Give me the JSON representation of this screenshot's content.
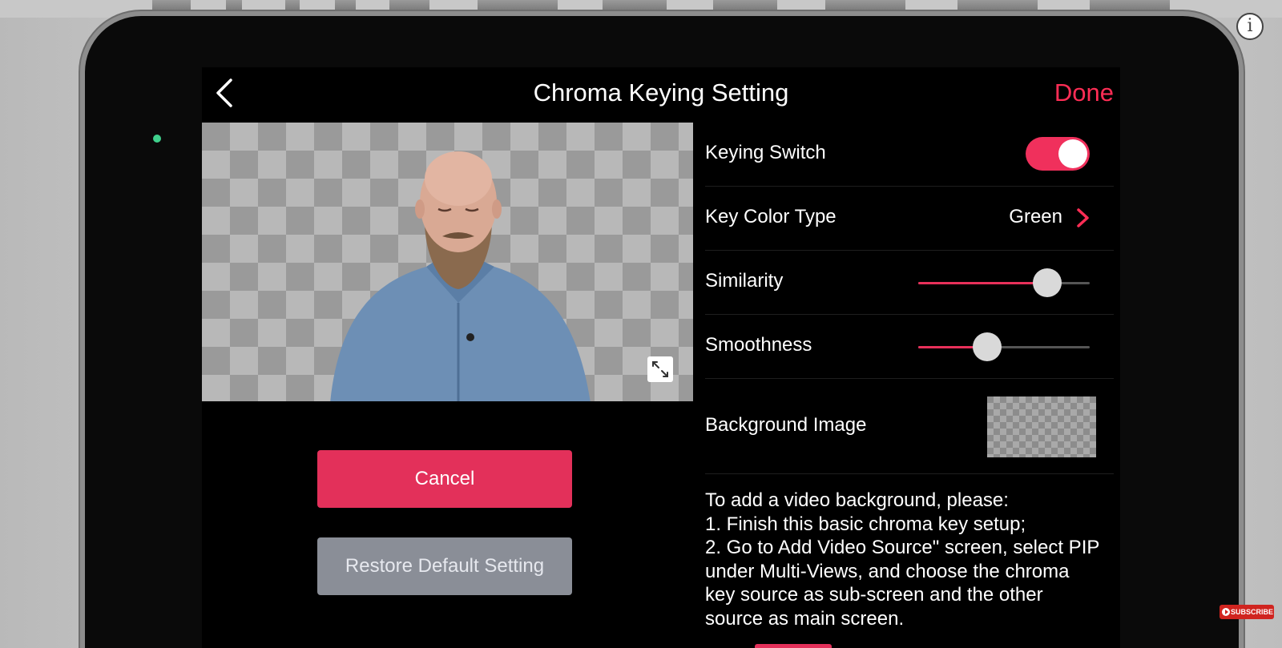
{
  "screen": {
    "title": "Chroma Keying Setting",
    "done_label": "Done"
  },
  "preview": {
    "expand_icon": "expand-arrows-icon"
  },
  "buttons": {
    "cancel": "Cancel",
    "restore": "Restore Default Setting"
  },
  "settings": {
    "keying_switch": {
      "label": "Keying Switch",
      "on": true
    },
    "key_color_type": {
      "label": "Key Color Type",
      "value": "Green"
    },
    "similarity": {
      "label": "Similarity",
      "level": 0.75
    },
    "smoothness": {
      "label": "Smoothness",
      "level": 0.4
    },
    "background_image": {
      "label": "Background Image"
    }
  },
  "note": {
    "lines": [
      "To add a video background, please:",
      "1. Finish this basic chroma key setup;",
      "2. Go to Add Video Source\" screen, select PIP",
      "under Multi-Views, and choose the chroma",
      "key source as sub-screen and the other",
      "source as main screen."
    ]
  },
  "overlay": {
    "info_label": "i",
    "subscribe_label": "SUBSCRIBE"
  },
  "colors": {
    "accent": "#ff2d55",
    "button_primary": "#e3305a",
    "button_secondary": "#8a8e97",
    "status_led": "#3fd08c"
  }
}
